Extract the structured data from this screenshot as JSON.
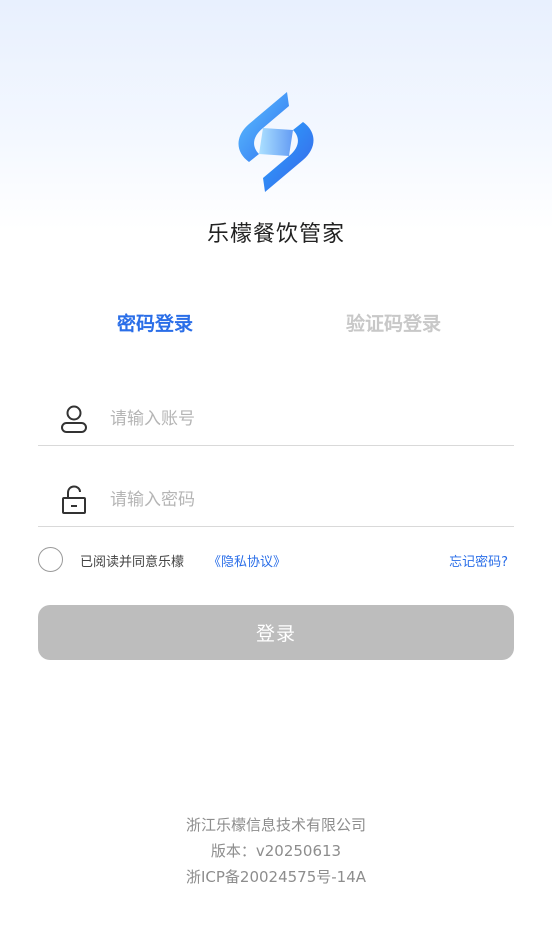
{
  "app": {
    "name": "乐檬餐饮管家",
    "logo_icon": "lemon-s-logo-icon",
    "accent_color": "#2a6ee8"
  },
  "tabs": [
    {
      "label": "密码登录",
      "active": true
    },
    {
      "label": "验证码登录",
      "active": false
    }
  ],
  "form": {
    "account": {
      "icon": "user-icon",
      "placeholder": "请输入账号",
      "value": ""
    },
    "password": {
      "icon": "lock-icon",
      "placeholder": "请输入密码",
      "value": ""
    }
  },
  "agreement": {
    "checked": false,
    "text": "已阅读并同意乐檬",
    "link": "《隐私协议》"
  },
  "forgot_password": "忘记密码?",
  "login_button": {
    "label": "登录",
    "disabled_color": "#bdbdbd"
  },
  "footer": {
    "company": "浙江乐檬信息技术有限公司",
    "version": "版本：v20250613",
    "icp": "浙ICP备20024575号-14A"
  }
}
